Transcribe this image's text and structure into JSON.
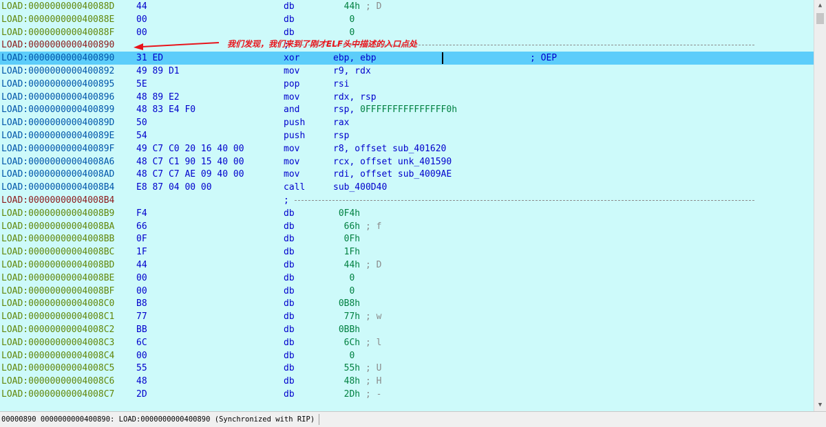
{
  "listing": {
    "rows": [
      {
        "addr": "LOAD:000000000040088D",
        "bytes": "44",
        "mnemonic": "db",
        "operand": "44h",
        "comment": "; D",
        "kind": "data"
      },
      {
        "addr": "LOAD:000000000040088E",
        "bytes": "00",
        "mnemonic": "db",
        "operand": "0",
        "comment": "",
        "kind": "data"
      },
      {
        "addr": "LOAD:000000000040088F",
        "bytes": "00",
        "mnemonic": "db",
        "operand": "0",
        "comment": "",
        "kind": "data"
      },
      {
        "addr": "LOAD:0000000000400890",
        "bytes": "",
        "mnemonic": ";",
        "operand": "",
        "comment": "",
        "kind": "sep"
      },
      {
        "addr": "LOAD:0000000000400890",
        "bytes": "31 ED",
        "mnemonic": "xor",
        "operand": "ebp, ebp",
        "comment": "; OEP",
        "kind": "code",
        "selected": true
      },
      {
        "addr": "LOAD:0000000000400892",
        "bytes": "49 89 D1",
        "mnemonic": "mov",
        "operand": "r9, rdx",
        "comment": "",
        "kind": "code"
      },
      {
        "addr": "LOAD:0000000000400895",
        "bytes": "5E",
        "mnemonic": "pop",
        "operand": "rsi",
        "comment": "",
        "kind": "code"
      },
      {
        "addr": "LOAD:0000000000400896",
        "bytes": "48 89 E2",
        "mnemonic": "mov",
        "operand": "rdx, rsp",
        "comment": "",
        "kind": "code"
      },
      {
        "addr": "LOAD:0000000000400899",
        "bytes": "48 83 E4 F0",
        "mnemonic": "and",
        "operand": "rsp, ",
        "operand_num": "0FFFFFFFFFFFFFFF0h",
        "comment": "",
        "kind": "code"
      },
      {
        "addr": "LOAD:000000000040089D",
        "bytes": "50",
        "mnemonic": "push",
        "operand": "rax",
        "comment": "",
        "kind": "code"
      },
      {
        "addr": "LOAD:000000000040089E",
        "bytes": "54",
        "mnemonic": "push",
        "operand": "rsp",
        "comment": "",
        "kind": "code"
      },
      {
        "addr": "LOAD:000000000040089F",
        "bytes": "49 C7 C0 20 16 40 00",
        "mnemonic": "mov",
        "operand": "r8, offset sub_401620",
        "comment": "",
        "kind": "code"
      },
      {
        "addr": "LOAD:00000000004008A6",
        "bytes": "48 C7 C1 90 15 40 00",
        "mnemonic": "mov",
        "operand": "rcx, offset unk_401590",
        "comment": "",
        "kind": "code"
      },
      {
        "addr": "LOAD:00000000004008AD",
        "bytes": "48 C7 C7 AE 09 40 00",
        "mnemonic": "mov",
        "operand": "rdi, offset sub_4009AE",
        "comment": "",
        "kind": "code"
      },
      {
        "addr": "LOAD:00000000004008B4",
        "bytes": "E8 87 04 00 00",
        "mnemonic": "call",
        "operand": "sub_400D40",
        "comment": "",
        "kind": "code"
      },
      {
        "addr": "LOAD:00000000004008B4",
        "bytes": "",
        "mnemonic": ";",
        "operand": "",
        "comment": "",
        "kind": "sep"
      },
      {
        "addr": "LOAD:00000000004008B9",
        "bytes": "F4",
        "mnemonic": "db",
        "operand": "0F4h",
        "comment": "",
        "kind": "data"
      },
      {
        "addr": "LOAD:00000000004008BA",
        "bytes": "66",
        "mnemonic": "db",
        "operand": "66h",
        "comment": "; f",
        "kind": "data"
      },
      {
        "addr": "LOAD:00000000004008BB",
        "bytes": "0F",
        "mnemonic": "db",
        "operand": "0Fh",
        "comment": "",
        "kind": "data"
      },
      {
        "addr": "LOAD:00000000004008BC",
        "bytes": "1F",
        "mnemonic": "db",
        "operand": "1Fh",
        "comment": "",
        "kind": "data"
      },
      {
        "addr": "LOAD:00000000004008BD",
        "bytes": "44",
        "mnemonic": "db",
        "operand": "44h",
        "comment": "; D",
        "kind": "data"
      },
      {
        "addr": "LOAD:00000000004008BE",
        "bytes": "00",
        "mnemonic": "db",
        "operand": "0",
        "comment": "",
        "kind": "data"
      },
      {
        "addr": "LOAD:00000000004008BF",
        "bytes": "00",
        "mnemonic": "db",
        "operand": "0",
        "comment": "",
        "kind": "data"
      },
      {
        "addr": "LOAD:00000000004008C0",
        "bytes": "B8",
        "mnemonic": "db",
        "operand": "0B8h",
        "comment": "",
        "kind": "data"
      },
      {
        "addr": "LOAD:00000000004008C1",
        "bytes": "77",
        "mnemonic": "db",
        "operand": "77h",
        "comment": "; w",
        "kind": "data"
      },
      {
        "addr": "LOAD:00000000004008C2",
        "bytes": "BB",
        "mnemonic": "db",
        "operand": "0BBh",
        "comment": "",
        "kind": "data"
      },
      {
        "addr": "LOAD:00000000004008C3",
        "bytes": "6C",
        "mnemonic": "db",
        "operand": "6Ch",
        "comment": "; l",
        "kind": "data"
      },
      {
        "addr": "LOAD:00000000004008C4",
        "bytes": "00",
        "mnemonic": "db",
        "operand": "0",
        "comment": "",
        "kind": "data"
      },
      {
        "addr": "LOAD:00000000004008C5",
        "bytes": "55",
        "mnemonic": "db",
        "operand": "55h",
        "comment": "; U",
        "kind": "data"
      },
      {
        "addr": "LOAD:00000000004008C6",
        "bytes": "48",
        "mnemonic": "db",
        "operand": "48h",
        "comment": "; H",
        "kind": "data"
      },
      {
        "addr": "LOAD:00000000004008C7",
        "bytes": "2D",
        "mnemonic": "db",
        "operand": "2Dh",
        "comment": "; -",
        "kind": "data"
      }
    ]
  },
  "annotation": {
    "text": "我们发现，我们来到了刚才ELF头中描述的入口点处",
    "color": "#e8141b"
  },
  "statusbar": {
    "text": "00000890 0000000000400890: LOAD:0000000000400890 (Synchronized with RIP)"
  },
  "scrollbar": {
    "up_icon": "scroll-up-arrow",
    "down_icon": "scroll-down-arrow"
  },
  "colors": {
    "background": "#cdfafa",
    "selected_row": "#5ccdfa",
    "data_address": "#61870a",
    "code_address": "#0055aa",
    "separator_address": "#8b1a1a",
    "instruction": "#0000cc",
    "number": "#008040",
    "comment": "#8a8a8a"
  }
}
